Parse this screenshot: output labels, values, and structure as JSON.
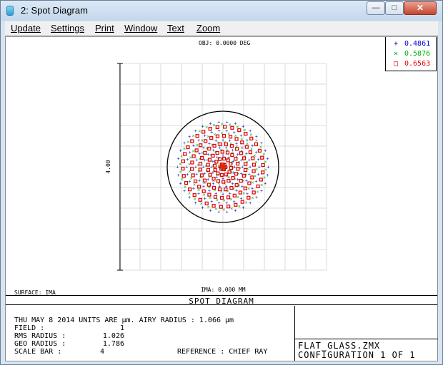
{
  "window": {
    "title": "2: Spot Diagram",
    "minimize_glyph": "—",
    "maximize_glyph": "□",
    "close_glyph": "✕"
  },
  "menu": [
    {
      "label": "Update"
    },
    {
      "label": "Settings"
    },
    {
      "label": "Print"
    },
    {
      "label": "Window"
    },
    {
      "label": "Text"
    },
    {
      "label": "Zoom"
    }
  ],
  "legend": [
    {
      "symbol": "+",
      "value": "0.4861",
      "color": "#0000cc"
    },
    {
      "symbol": "×",
      "value": "0.5876",
      "color": "#00cc00"
    },
    {
      "symbol": "□",
      "value": "0.6563",
      "color": "#dd0000"
    }
  ],
  "plot": {
    "obj_label": "OBJ: 0.0000 DEG",
    "ima_label": "IMA: 0.000 MM",
    "scale_label": "4.00",
    "surface_label": "SURFACE: IMA"
  },
  "spot_title": "SPOT DIAGRAM",
  "info": {
    "line1": "THU MAY 8 2014  UNITS ARE µm.  AIRY RADIUS : 1.066 µm",
    "field_label": "FIELD       :",
    "field_value": "1",
    "rms_label": "RMS RADIUS  :",
    "rms_value": "1.026",
    "geo_label": "GEO RADIUS  :",
    "geo_value": "1.786",
    "scale_label": "SCALE BAR   :",
    "scale_value": "4",
    "reference": "REFERENCE   : CHIEF RAY"
  },
  "file": {
    "name": "FLAT_GLASS.ZMX",
    "config": "CONFIGURATION 1 OF 1"
  },
  "chart_data": {
    "type": "scatter",
    "title": "",
    "xlabel": "",
    "ylabel": "",
    "units": "µm",
    "scale_bar": 4,
    "airy_radius": 1.066,
    "wavelengths": [
      {
        "name": "0.4861",
        "color": "#0000cc",
        "ring_radii": [
          0.15,
          0.45,
          0.75,
          1.05,
          1.4,
          1.75
        ],
        "ring_points": [
          6,
          12,
          18,
          24,
          30,
          34
        ]
      },
      {
        "name": "0.5876",
        "color": "#00b000",
        "ring_radii": [
          0.12,
          0.38,
          0.65,
          0.95,
          1.3,
          1.65
        ],
        "ring_points": [
          6,
          12,
          18,
          24,
          30,
          34
        ]
      },
      {
        "name": "0.6563",
        "color": "#dd0000",
        "ring_radii": [
          0.1,
          0.32,
          0.58,
          0.88,
          1.2,
          1.55
        ],
        "ring_points": [
          6,
          12,
          18,
          24,
          30,
          34
        ]
      }
    ]
  }
}
